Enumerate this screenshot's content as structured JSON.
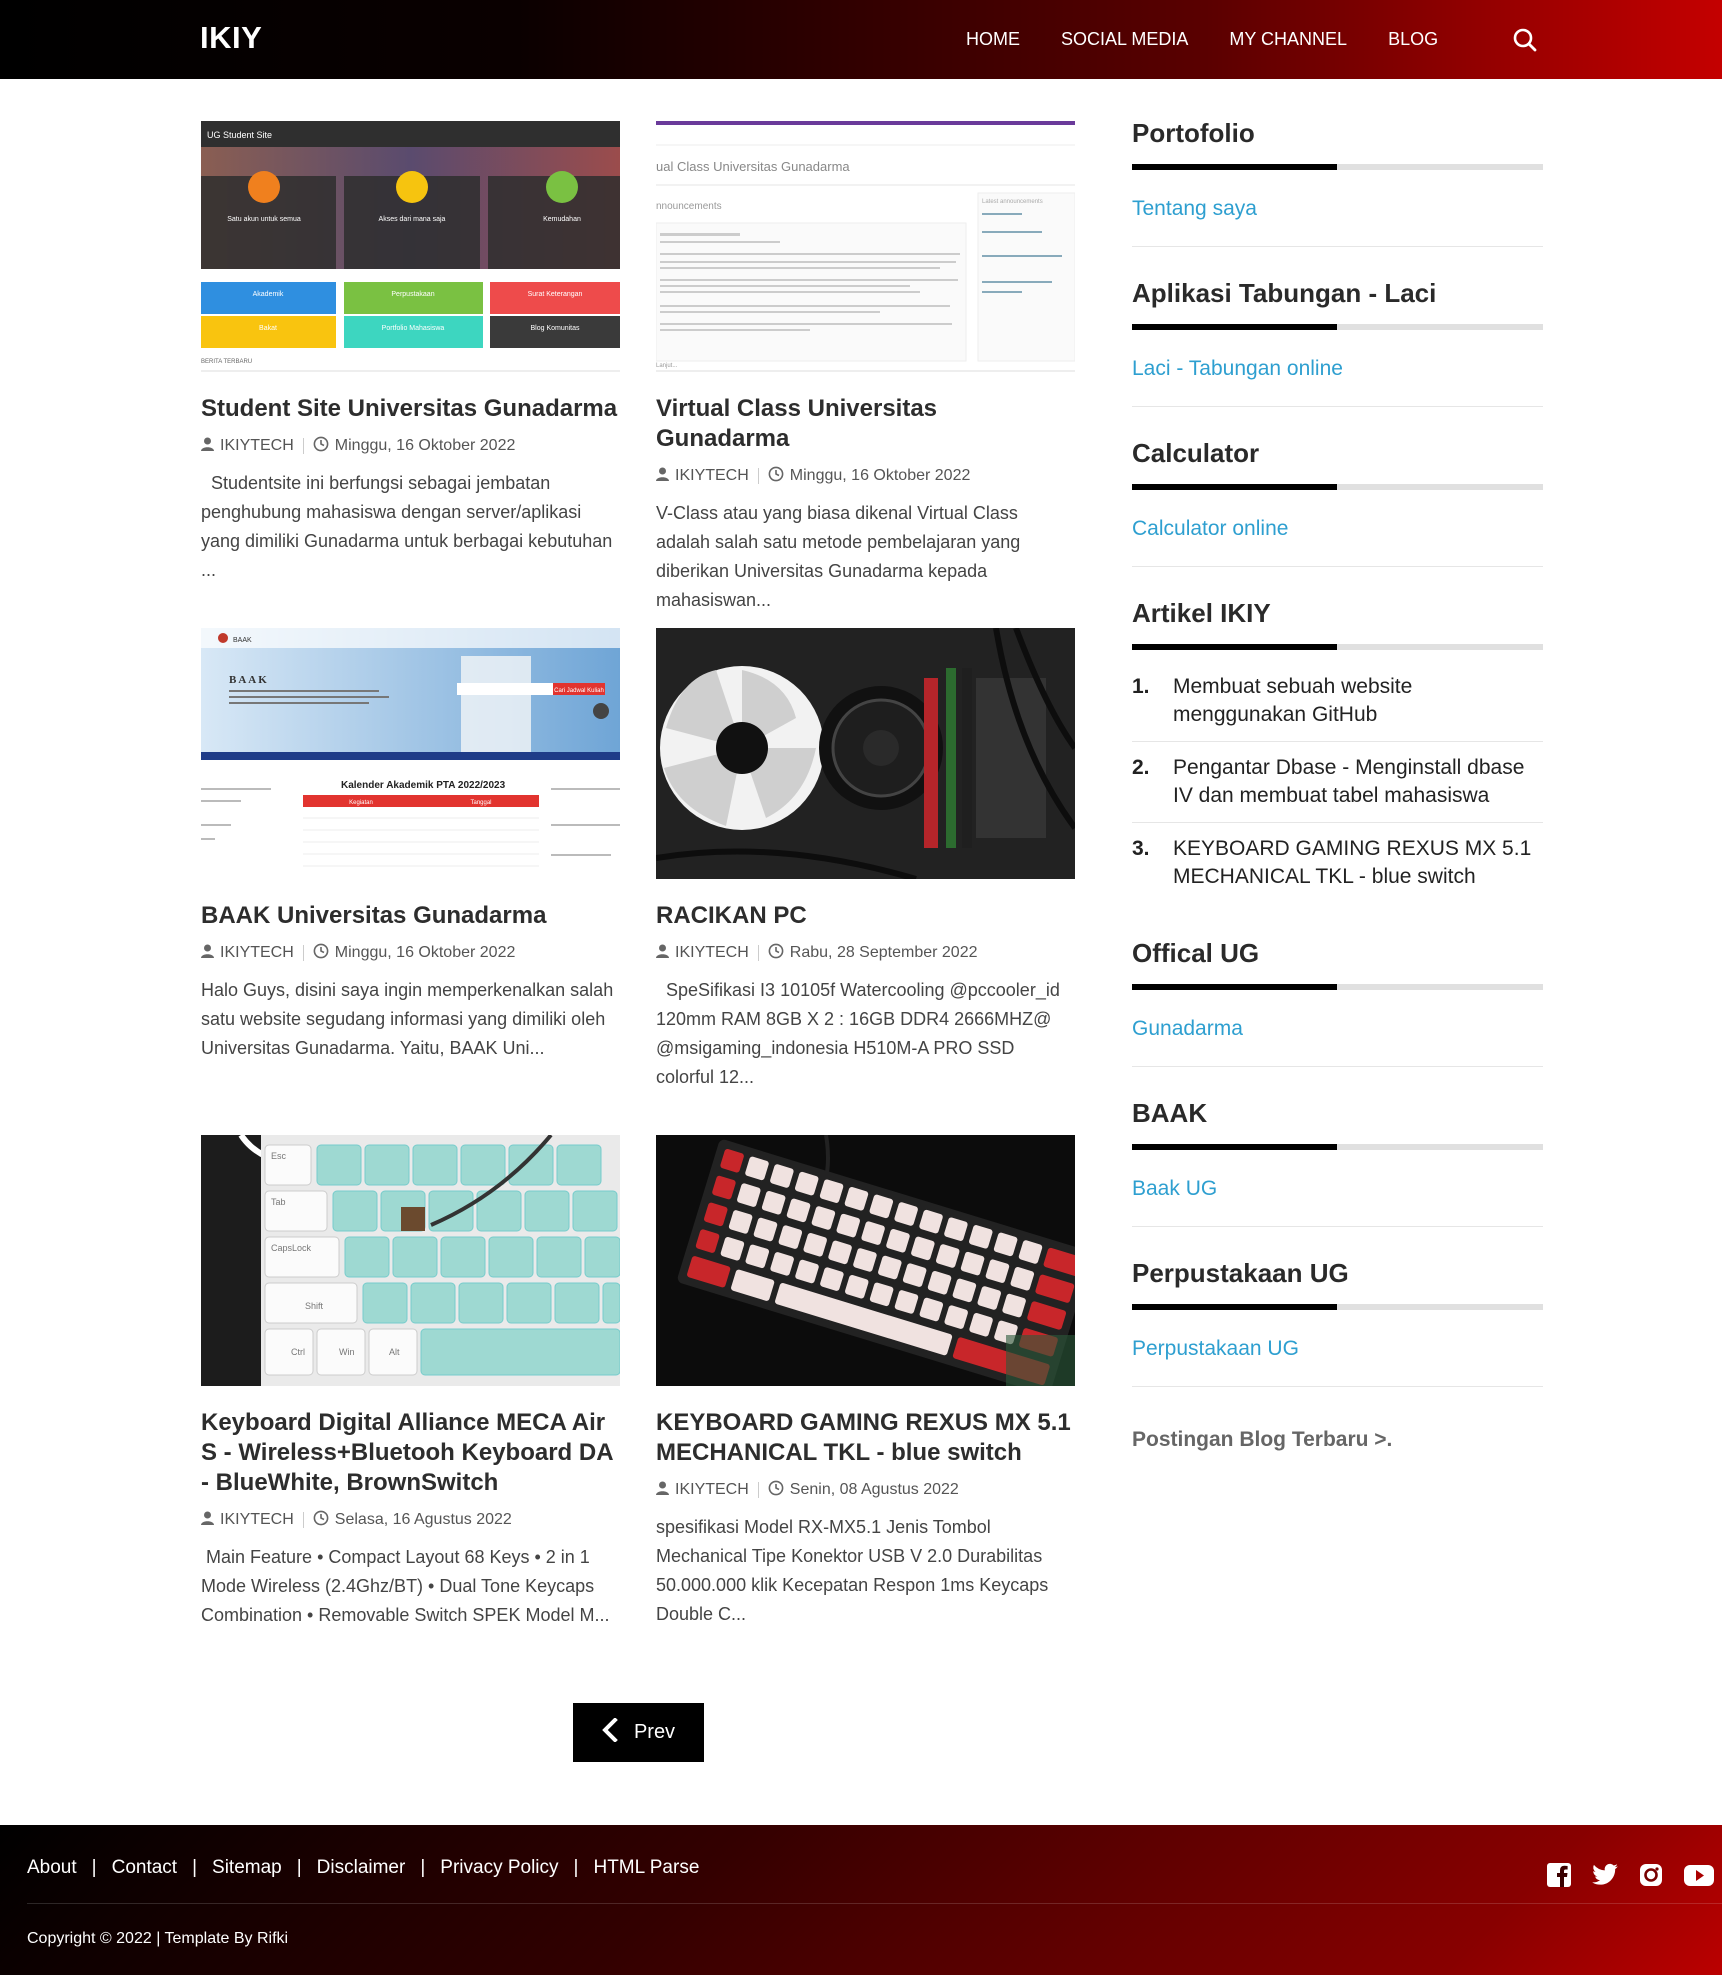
{
  "header": {
    "logo": "IKIY",
    "nav": [
      "HOME",
      "SOCIAL MEDIA",
      "MY CHANNEL",
      "BLOG"
    ],
    "search_icon": "search-icon"
  },
  "posts": [
    {
      "title": "Student Site Universitas Gunadarma",
      "author": "IKIYTECH",
      "date": "Minggu, 16 Oktober 2022",
      "snippet": "  Studentsite ini berfungsi sebagai jembatan penghubung mahasiswa dengan server/aplikasi yang dimiliki Gunadarma untuk berbagai kebutuhan ..."
    },
    {
      "title": "Virtual Class Universitas Gunadarma",
      "author": "IKIYTECH",
      "date": "Minggu, 16 Oktober 2022",
      "snippet": "V-Class atau yang biasa dikenal Virtual Class adalah salah satu metode pembelajaran yang diberikan Universitas Gunadarma kepada mahasiswan..."
    },
    {
      "title": "BAAK Universitas Gunadarma",
      "author": "IKIYTECH",
      "date": "Minggu, 16 Oktober 2022",
      "snippet": "Halo Guys, disini saya ingin memperkenalkan salah satu website segudang informasi yang dimiliki oleh Universitas Gunadarma. Yaitu, BAAK Uni..."
    },
    {
      "title": "RACIKAN PC",
      "author": "IKIYTECH",
      "date": "Rabu, 28 September 2022",
      "snippet": "  SpeSifikasi I3 10105f Watercooling @pccooler_id 120mm RAM 8GB X 2 : 16GB DDR4 2666MHZ@ @msigaming_indonesia H510M-A PRO SSD colorful 12..."
    },
    {
      "title": "Keyboard Digital Alliance MECA Air S - Wireless+Bluetooh Keyboard DA - BlueWhite, BrownSwitch",
      "author": "IKIYTECH",
      "date": "Selasa, 16 Agustus 2022",
      "snippet": " Main Feature • Compact Layout 68 Keys • 2 in 1 Mode Wireless (2.4Ghz/BT) • Dual Tone Keycaps Combination • Removable Switch SPEK Model M..."
    },
    {
      "title": "KEYBOARD GAMING REXUS MX 5.1 MECHANICAL TKL - blue switch",
      "author": "IKIYTECH",
      "date": "Senin, 08 Agustus 2022",
      "snippet": "spesifikasi Model RX-MX5.1 Jenis Tombol Mechanical Tipe Konektor USB V 2.0 Durabilitas 50.000.000 klik Kecepatan Respon 1ms Keycaps Double C..."
    }
  ],
  "thumbs": {
    "studentsite": {
      "site_name": "UG Student Site",
      "tiles": [
        "Satu akun untuk semua",
        "Akses dari mana saja",
        "Kemudahan"
      ],
      "menu": [
        "Akademik",
        "Perpustakaan",
        "Surat Keterangan",
        "Bakat",
        "Portfolio Mahasiswa",
        "Blog Komunitas"
      ],
      "footer": "BERITA TERBARU"
    },
    "vclass": {
      "heading": "ual Class Universitas Gunadarma",
      "section": "nnouncements",
      "side": "Latest announcements",
      "footer": "Lanjut..."
    },
    "baak": {
      "site_name": "BAAK",
      "hero_title": "BAAK",
      "search_btn": "Cari Jadwal Kuliah",
      "calendar_title": "Kalender Akademik PTA 2022/2023",
      "col_a": "Kegiatan",
      "col_b": "Tanggal"
    },
    "keyboard_keys": [
      "Esc",
      "Tab",
      "CapsLock",
      "Shift",
      "Ctrl",
      "Win",
      "Alt"
    ]
  },
  "pagination": {
    "prev": "Prev"
  },
  "sidebar": {
    "widgets": [
      {
        "title": "Portofolio",
        "link": "Tentang saya"
      },
      {
        "title": "Aplikasi Tabungan - Laci",
        "link": "Laci - Tabungan online"
      },
      {
        "title": "Calculator",
        "link": "Calculator online"
      }
    ],
    "articles": {
      "title": "Artikel IKIY",
      "items": [
        {
          "num": "1.",
          "text": "Membuat sebuah website menggunakan GitHub"
        },
        {
          "num": "2.",
          "text": "Pengantar Dbase - Menginstall dbase IV dan membuat tabel mahasiswa"
        },
        {
          "num": "3.",
          "text": "KEYBOARD GAMING REXUS MX 5.1 MECHANICAL TKL - blue switch"
        }
      ]
    },
    "widgets2": [
      {
        "title": "Offical UG",
        "link": "Gunadarma"
      },
      {
        "title": "BAAK",
        "link": "Baak UG"
      },
      {
        "title": "Perpustakaan UG",
        "link": "Perpustakaan UG"
      }
    ],
    "more": "Postingan Blog Terbaru >."
  },
  "footer": {
    "links": [
      "About",
      "Contact",
      "Sitemap",
      "Disclaimer",
      "Privacy Policy",
      "HTML Parse"
    ],
    "social": [
      "facebook-icon",
      "twitter-icon",
      "instagram-icon",
      "youtube-icon"
    ],
    "copyright": "Copyright © 2022 | Template By Rifki"
  },
  "colors": {
    "accent_link": "#2e9fd0",
    "header_start": "#000000",
    "header_end": "#c40000"
  }
}
